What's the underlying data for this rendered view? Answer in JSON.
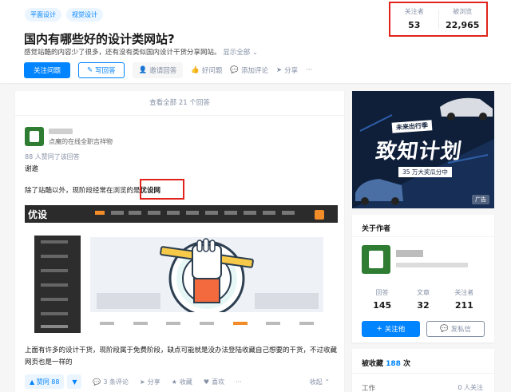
{
  "topics": [
    "平面设计",
    "视觉设计"
  ],
  "question": {
    "title": "国内有哪些好的设计类网站?",
    "description": "感觉站酷的内容少了很多，还有没有类似国内设计干货分享网站。",
    "show_all": "显示全部 ⌄"
  },
  "actions": {
    "follow": "关注问题",
    "write": "写回答",
    "invite": "邀请回答",
    "good_question": "好问题",
    "comment": "添加评论",
    "share": "分享",
    "more": "···"
  },
  "stats": {
    "followers_label": "关注者",
    "followers": "53",
    "views_label": "被浏览",
    "views": "22,965"
  },
  "answers": {
    "view_all": "查看全部 21 个回答",
    "author_bio": "点魔的在线全职吉祥物",
    "votes_line": "88 人赞同了该回答",
    "p1": "谢邀",
    "p2_prefix": "除了站酷以外，现阶段经常在浏览的是",
    "p2_highlight": "优设网",
    "screenshot_logo": "优设",
    "p3": "上面有许多的设计干货，现阶段属于免费阶段，缺点可能就是没办法登陆收藏自己想要的干货，不过收藏网页也是一样的",
    "upvote": "▲ 赞同 88",
    "downvote": "▼",
    "comments": "3 条评论",
    "share": "分享",
    "collect": "收藏",
    "like": "喜欢",
    "collapse": "收起 ⌃"
  },
  "ad": {
    "tag": "未来出行季",
    "headline": "致知计划",
    "sub": "35 万大奖瓜分中",
    "badge": "广告"
  },
  "about": {
    "title": "关于作者",
    "answers_label": "回答",
    "answers": "145",
    "articles_label": "文章",
    "articles": "32",
    "followers_label": "关注者",
    "followers": "211",
    "follow_btn": "关注他",
    "message_btn": "发私信"
  },
  "collected": {
    "label": "被收藏",
    "count": "188",
    "unit": "次",
    "row_label": "工作",
    "row_right": "0 人关注"
  }
}
